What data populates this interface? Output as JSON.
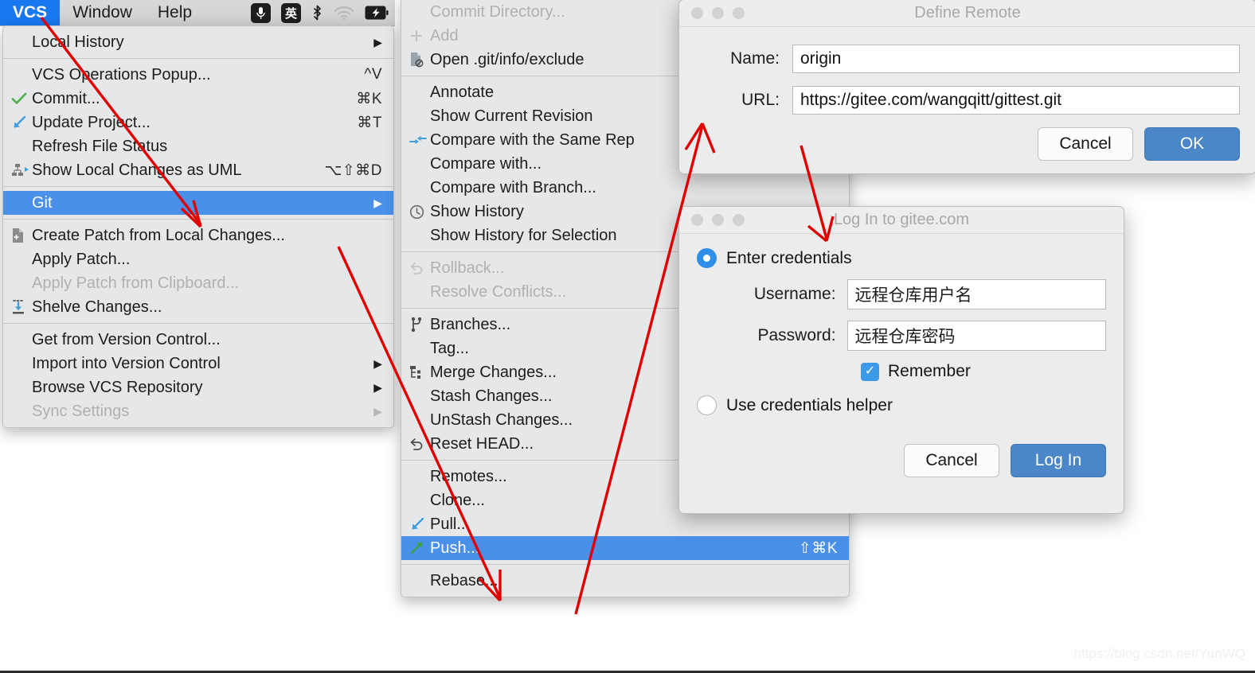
{
  "menubar": {
    "items": [
      {
        "label": "VCS",
        "active": true
      },
      {
        "label": "Window",
        "active": false
      },
      {
        "label": "Help",
        "active": false
      }
    ],
    "status_icons": [
      "microphone-icon",
      "ime-chinese-icon",
      "bluetooth-icon",
      "wifi-icon",
      "battery-charging-icon"
    ],
    "ime_glyph": "英"
  },
  "vcs_menu": {
    "groups": [
      {
        "items": [
          {
            "icon": "",
            "label": "Local History",
            "accel": "",
            "submenu": true,
            "disabled": false,
            "selected": false
          }
        ]
      },
      {
        "items": [
          {
            "icon": "",
            "label": "VCS Operations Popup...",
            "accel": "^V",
            "submenu": false,
            "disabled": false,
            "selected": false
          },
          {
            "icon": "check-green-icon",
            "label": "Commit...",
            "accel": "⌘K",
            "submenu": false,
            "disabled": false,
            "selected": false
          },
          {
            "icon": "arrow-down-left-blue-icon",
            "label": "Update Project...",
            "accel": "⌘T",
            "submenu": false,
            "disabled": false,
            "selected": false
          },
          {
            "icon": "",
            "label": "Refresh File Status",
            "accel": "",
            "submenu": false,
            "disabled": false,
            "selected": false
          },
          {
            "icon": "uml-diagram-icon",
            "label": "Show Local Changes as UML",
            "accel": "⌥⇧⌘D",
            "submenu": false,
            "disabled": false,
            "selected": false
          }
        ]
      },
      {
        "items": [
          {
            "icon": "",
            "label": "Git",
            "accel": "",
            "submenu": true,
            "disabled": false,
            "selected": true
          }
        ]
      },
      {
        "items": [
          {
            "icon": "patch-file-icon",
            "label": "Create Patch from Local Changes...",
            "accel": "",
            "submenu": false,
            "disabled": false,
            "selected": false
          },
          {
            "icon": "",
            "label": "Apply Patch...",
            "accel": "",
            "submenu": false,
            "disabled": false,
            "selected": false
          },
          {
            "icon": "",
            "label": "Apply Patch from Clipboard...",
            "accel": "",
            "submenu": false,
            "disabled": true,
            "selected": false
          },
          {
            "icon": "shelve-download-icon",
            "label": "Shelve Changes...",
            "accel": "",
            "submenu": false,
            "disabled": false,
            "selected": false
          }
        ]
      },
      {
        "items": [
          {
            "icon": "",
            "label": "Get from Version Control...",
            "accel": "",
            "submenu": false,
            "disabled": false,
            "selected": false
          },
          {
            "icon": "",
            "label": "Import into Version Control",
            "accel": "",
            "submenu": true,
            "disabled": false,
            "selected": false
          },
          {
            "icon": "",
            "label": "Browse VCS Repository",
            "accel": "",
            "submenu": true,
            "disabled": false,
            "selected": false
          },
          {
            "icon": "",
            "label": "Sync Settings",
            "accel": "",
            "submenu": true,
            "disabled": true,
            "selected": false
          }
        ]
      }
    ]
  },
  "git_menu": {
    "groups": [
      {
        "items": [
          {
            "icon": "",
            "label": "Commit Directory...",
            "accel": "",
            "submenu": false,
            "disabled": true,
            "selected": false
          },
          {
            "icon": "plus-icon",
            "label": "Add",
            "accel": "",
            "submenu": false,
            "disabled": true,
            "selected": false
          },
          {
            "icon": "exclude-file-icon",
            "label": "Open .git/info/exclude",
            "accel": "",
            "submenu": false,
            "disabled": false,
            "selected": false
          }
        ]
      },
      {
        "items": [
          {
            "icon": "",
            "label": "Annotate",
            "accel": "",
            "submenu": false,
            "disabled": false,
            "selected": false
          },
          {
            "icon": "",
            "label": "Show Current Revision",
            "accel": "",
            "submenu": false,
            "disabled": false,
            "selected": false
          },
          {
            "icon": "compare-same-repo-icon",
            "label": "Compare with the Same Rep",
            "accel": "",
            "submenu": false,
            "disabled": false,
            "selected": false
          },
          {
            "icon": "",
            "label": "Compare with...",
            "accel": "",
            "submenu": false,
            "disabled": false,
            "selected": false
          },
          {
            "icon": "",
            "label": "Compare with Branch...",
            "accel": "",
            "submenu": false,
            "disabled": false,
            "selected": false
          },
          {
            "icon": "clock-history-icon",
            "label": "Show History",
            "accel": "",
            "submenu": false,
            "disabled": false,
            "selected": false
          },
          {
            "icon": "",
            "label": "Show History for Selection",
            "accel": "",
            "submenu": false,
            "disabled": false,
            "selected": false
          }
        ]
      },
      {
        "items": [
          {
            "icon": "rollback-icon",
            "label": "Rollback...",
            "accel": "",
            "submenu": false,
            "disabled": true,
            "selected": false
          },
          {
            "icon": "",
            "label": "Resolve Conflicts...",
            "accel": "",
            "submenu": false,
            "disabled": true,
            "selected": false
          }
        ]
      },
      {
        "items": [
          {
            "icon": "branch-icon",
            "label": "Branches...",
            "accel": "",
            "submenu": false,
            "disabled": false,
            "selected": false
          },
          {
            "icon": "",
            "label": "Tag...",
            "accel": "",
            "submenu": false,
            "disabled": false,
            "selected": false
          },
          {
            "icon": "merge-icon",
            "label": "Merge Changes...",
            "accel": "",
            "submenu": false,
            "disabled": false,
            "selected": false
          },
          {
            "icon": "",
            "label": "Stash Changes...",
            "accel": "",
            "submenu": false,
            "disabled": false,
            "selected": false
          },
          {
            "icon": "",
            "label": "UnStash Changes...",
            "accel": "",
            "submenu": false,
            "disabled": false,
            "selected": false
          },
          {
            "icon": "reset-head-icon",
            "label": "Reset HEAD...",
            "accel": "",
            "submenu": false,
            "disabled": false,
            "selected": false
          }
        ]
      },
      {
        "items": [
          {
            "icon": "",
            "label": "Remotes...",
            "accel": "",
            "submenu": false,
            "disabled": false,
            "selected": false
          },
          {
            "icon": "",
            "label": "Clone...",
            "accel": "",
            "submenu": false,
            "disabled": false,
            "selected": false
          },
          {
            "icon": "pull-arrow-icon",
            "label": "Pull...",
            "accel": "",
            "submenu": false,
            "disabled": false,
            "selected": false
          },
          {
            "icon": "push-arrow-icon",
            "label": "Push...",
            "accel": "⇧⌘K",
            "submenu": false,
            "disabled": false,
            "selected": true
          }
        ]
      },
      {
        "items": [
          {
            "icon": "",
            "label": "Rebase...",
            "accel": "",
            "submenu": false,
            "disabled": false,
            "selected": false
          }
        ]
      }
    ]
  },
  "define_remote_dialog": {
    "title": "Define Remote",
    "name_label": "Name:",
    "name_value": "origin",
    "url_label": "URL:",
    "url_value": "https://gitee.com/wangqitt/gittest.git",
    "cancel_label": "Cancel",
    "ok_label": "OK"
  },
  "login_dialog": {
    "title": "Log In to gitee.com",
    "enter_credentials_label": "Enter credentials",
    "username_label": "Username:",
    "username_value": "远程仓库用户名",
    "password_label": "Password:",
    "password_value": "远程仓库密码",
    "remember_label": "Remember",
    "remember_checked": true,
    "helper_label": "Use credentials helper",
    "cancel_label": "Cancel",
    "login_label": "Log In"
  },
  "watermark": "https://blog.csdn.net/YunWQ",
  "colors": {
    "menu_highlight": "#4a90e8",
    "menubar_active": "#1878f0",
    "primary_button": "#4a86c8",
    "annotation_arrow": "#e00000",
    "menu_background": "#e6e7e8"
  }
}
